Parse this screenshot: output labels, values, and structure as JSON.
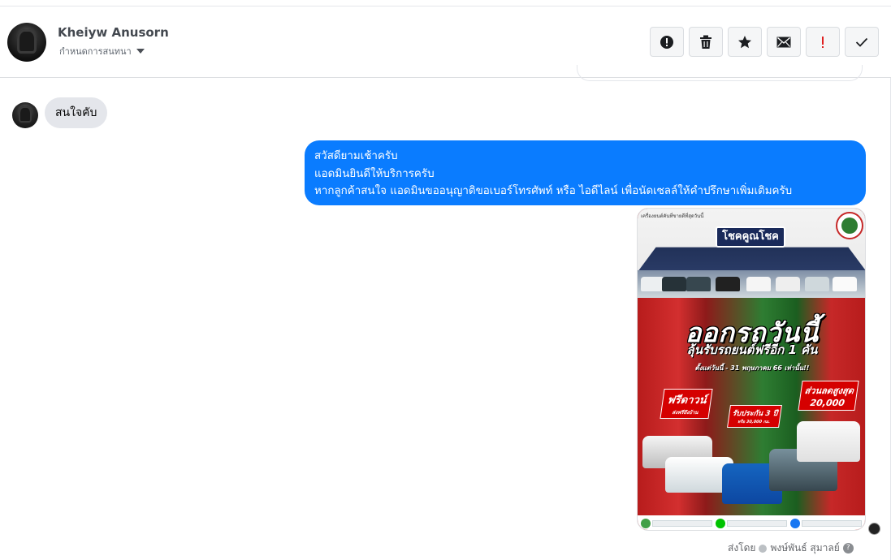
{
  "header": {
    "contact_name": "Kheiyw Anusorn",
    "assign_label": "กำหนดการสนทนา",
    "toolbar": [
      {
        "id": "spam",
        "icon": "alert-circle-icon"
      },
      {
        "id": "delete",
        "icon": "trash-icon"
      },
      {
        "id": "star",
        "icon": "star-icon"
      },
      {
        "id": "unread",
        "icon": "envelope-icon"
      },
      {
        "id": "follow-up",
        "icon": "exclamation-icon",
        "color": "#e02020"
      },
      {
        "id": "done",
        "icon": "checkmark-icon"
      }
    ]
  },
  "messages": {
    "incoming": {
      "text": "สนใจคับ"
    },
    "outgoing": {
      "lines": [
        "สวัสดียามเช้าครับ",
        "แอดมินยินดีให้บริการครับ",
        "หากลูกค้าสนใจ แอดมินขออนุญาติขอเบอร์โทรศัพท์ หรือ ไอดีไลน์ เพื่อนัดเซลล์ให้คำปรึกษาเพิ่มเติมครับ"
      ],
      "bubble_color": "#0a7cff"
    },
    "attachment": {
      "top_tag": "เครื่องยนต์คันที่ขายดีที่สุดวันนี้",
      "sign": "โชคคูณโชค",
      "headline": "ออกรถวันนี้",
      "subheadline": "ลุ้นรับรถยนต์ฟรีอีก 1 คัน",
      "date_line": "ตั้งแต่วันนี้ - 31 พฤษภาคม 66 เท่านั้น!!",
      "badge_free_down": "ฟรีดาวน์",
      "badge_free_down_sub": "ส่งฟรีถึงบ้าน",
      "badge_discount": "ส่วนลดสูงสุด",
      "badge_discount_value": "20,000",
      "badge_warranty": "รับประกัน 3 ปี",
      "badge_warranty_sub": "หรือ 30,000 กม."
    }
  },
  "footer": {
    "sent_by_label": "ส่งโดย",
    "sender_name": "พงษ์พันธ์ สุมาลย์"
  }
}
